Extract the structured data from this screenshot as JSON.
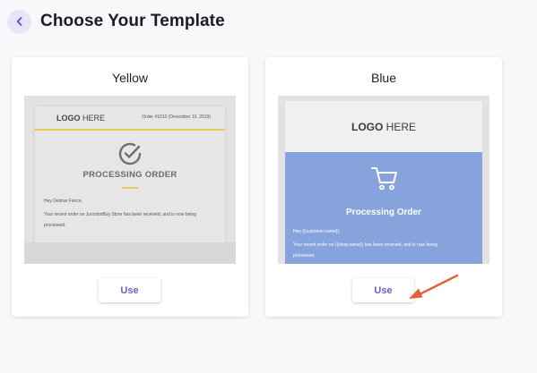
{
  "header": {
    "back_icon": "chevron-left-icon",
    "title": "Choose Your Template"
  },
  "templates": [
    {
      "name": "Yellow",
      "button_label": "Use",
      "accent_color": "#e7c95e",
      "preview": {
        "logo_bold": "LOGO",
        "logo_rest": " HERE",
        "order_meta": "Order #1010 (December 10, 2019)",
        "icon": "check-circle-icon",
        "heading": "PROCESSING ORDER",
        "greeting": "Hey Delmar Fierce,",
        "body": "Your recent order on JunctionBuy Store has been received, and is now being",
        "body2": "processed."
      }
    },
    {
      "name": "Blue",
      "button_label": "Use",
      "accent_color": "#86a3dc",
      "preview": {
        "logo_bold": "LOGO",
        "logo_rest": " HERE",
        "icon": "shopping-cart-icon",
        "heading": "Processing Order",
        "greeting": "Hey {{customer.name}},",
        "body": "Your recent order on {{shop.name}} has been received, and is now being",
        "body2": "processed."
      }
    }
  ],
  "annotation": {
    "icon": "pointer-arrow-icon",
    "color": "#e0613a"
  }
}
